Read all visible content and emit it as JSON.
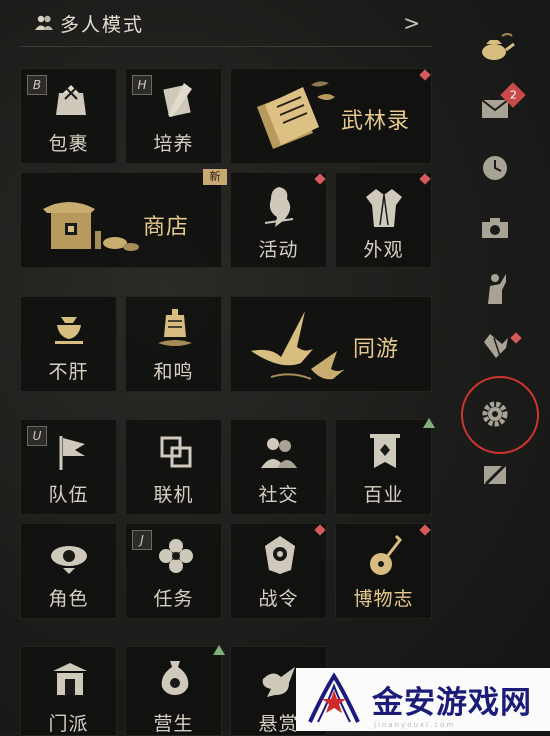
{
  "header": {
    "mode_label": "多人模式",
    "chevron": ">"
  },
  "tiles": {
    "bag": {
      "label": "包裹",
      "key": "B"
    },
    "train": {
      "label": "培养",
      "key": "H"
    },
    "wulin": {
      "label": "武林录"
    },
    "shop": {
      "label": "商店",
      "badge": "新"
    },
    "event": {
      "label": "活动"
    },
    "look": {
      "label": "外观"
    },
    "buxiang": {
      "label": "不肝"
    },
    "hewu": {
      "label": "和鸣"
    },
    "tongyou": {
      "label": "同游"
    },
    "team": {
      "label": "队伍",
      "key": "U"
    },
    "online": {
      "label": "联机"
    },
    "social": {
      "label": "社交"
    },
    "baiye": {
      "label": "百业"
    },
    "role": {
      "label": "角色"
    },
    "task": {
      "label": "任务",
      "key": "J"
    },
    "zhanling": {
      "label": "战令"
    },
    "bowuzhi": {
      "label": "博物志"
    },
    "row6a": {
      "label": "门派"
    },
    "row6b": {
      "label": "营生"
    },
    "row6c": {
      "label": "悬赏"
    }
  },
  "sidebar": {
    "items": [
      {
        "icon": "teapot-icon"
      },
      {
        "icon": "mail-icon",
        "badge": "2"
      },
      {
        "icon": "clock-icon"
      },
      {
        "icon": "camera-icon"
      },
      {
        "icon": "figure-icon"
      },
      {
        "icon": "gesture-icon"
      },
      {
        "icon": "gear-icon"
      },
      {
        "icon": "exit-icon"
      }
    ]
  },
  "watermark": {
    "text": "金安游戏网",
    "sub": "jinanyouxi.com"
  },
  "colors": {
    "accent_gold": "#e6c98c",
    "badge_red": "#d65a5a",
    "annotation_red": "#d0352f"
  }
}
